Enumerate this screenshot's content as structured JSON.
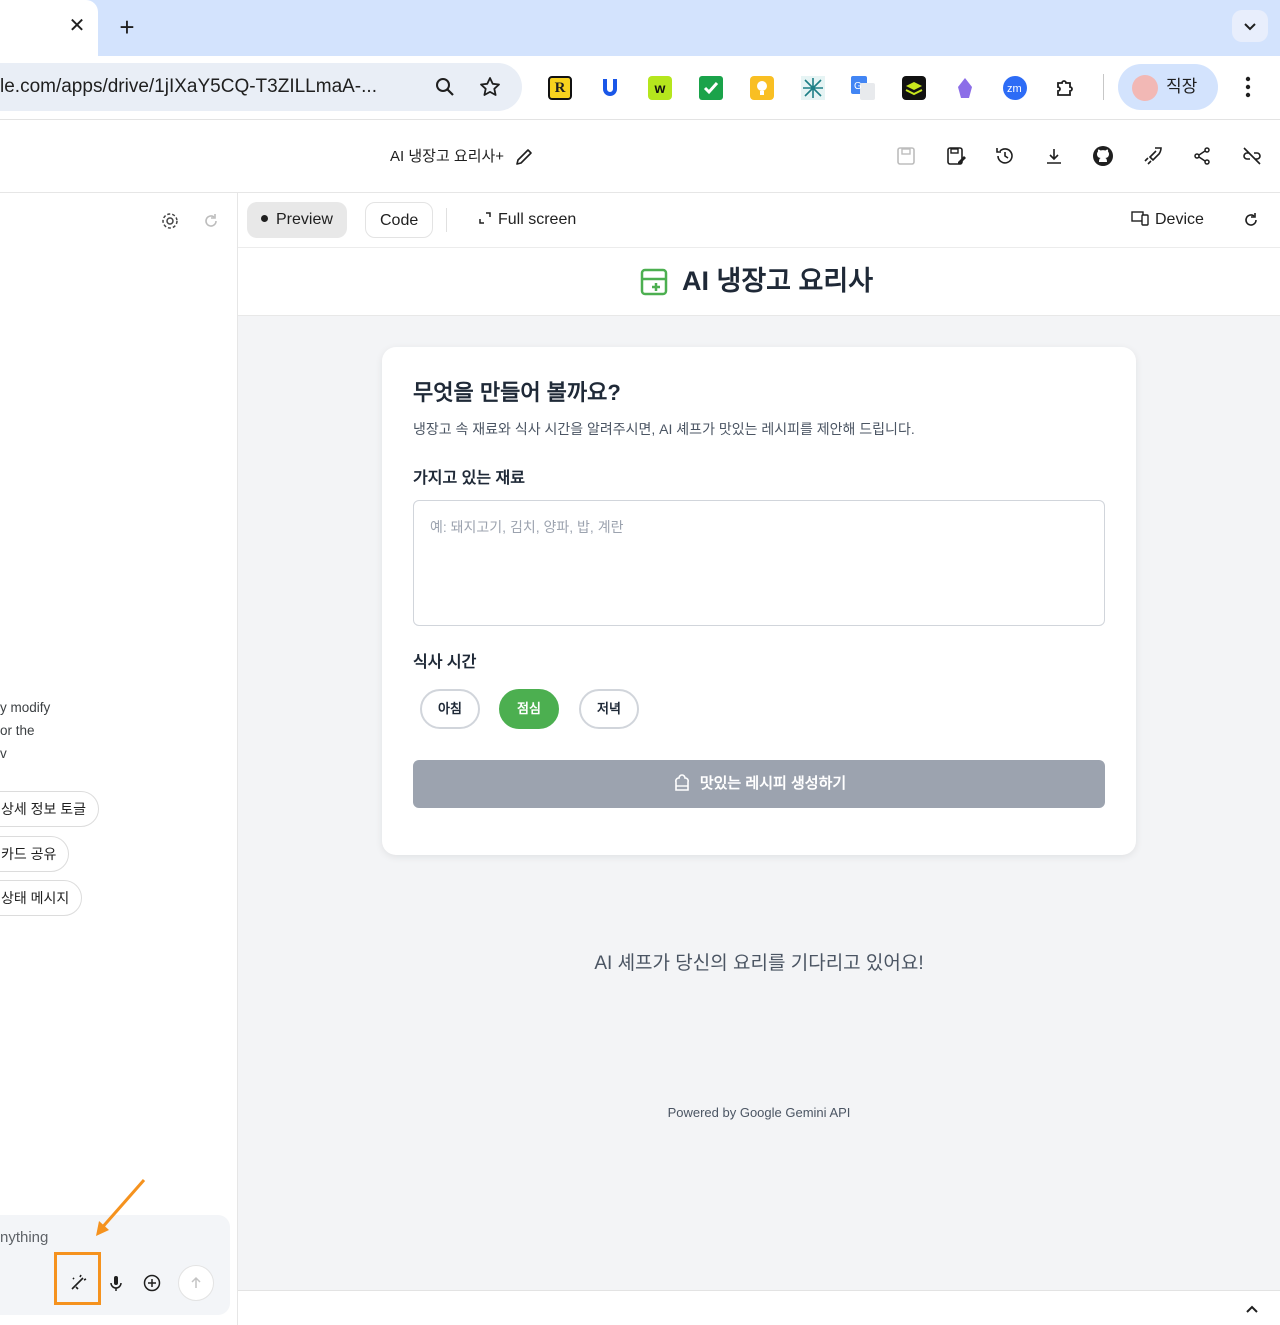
{
  "browser": {
    "tab_close_glyph": "✕",
    "new_tab_glyph": "+",
    "url": "le.com/apps/drive/1jIXaY5CQ-T3ZILLmaA-...",
    "profile_name": "직장",
    "extensions": [
      {
        "name": "r-extension-icon",
        "color": "#f7d21e"
      },
      {
        "name": "u-extension-icon",
        "color": "#1a57e8"
      },
      {
        "name": "w-extension-icon",
        "color": "#b5e61d"
      },
      {
        "name": "check-extension-icon",
        "color": "#1aa34a"
      },
      {
        "name": "bulb-extension-icon",
        "color": "#f9bf23"
      },
      {
        "name": "network-extension-icon",
        "color": "#1d7f86"
      },
      {
        "name": "translate-extension-icon",
        "color": "#4285f4"
      },
      {
        "name": "layers-extension-icon",
        "color": "#111111"
      },
      {
        "name": "crystal-extension-icon",
        "color": "#8c6ee8"
      },
      {
        "name": "zoom-extension-icon",
        "color": "#2d6cf6"
      }
    ]
  },
  "app_header": {
    "title": "AI 냉장고 요리사+"
  },
  "left_panel": {
    "text_lines": [
      "y modify",
      "or the",
      "v"
    ],
    "chips": [
      "상세 정보 토글",
      "카드 공유",
      "상태 메시지"
    ],
    "composer_placeholder": "nything"
  },
  "preview_bar": {
    "preview_label": "Preview",
    "code_label": "Code",
    "fullscreen_label": "Full screen",
    "device_label": "Device"
  },
  "app": {
    "title": "AI 냉장고 요리사",
    "card_title": "무엇을 만들어 볼까요?",
    "card_subtitle": "냉장고 속 재료와 식사 시간을 알려주시면, AI 셰프가 맛있는 레시피를 제안해 드립니다.",
    "ingredients_label": "가지고 있는 재료",
    "ingredients_value": "",
    "ingredients_placeholder": "예: 돼지고기, 김치, 양파, 밥, 계란",
    "meal_label": "식사 시간",
    "meal_options": [
      "아침",
      "점심",
      "저녁"
    ],
    "meal_selected": "점심",
    "generate_label": "맛있는 레시피 생성하기",
    "waiting_message": "AI 셰프가 당신의 요리를 기다리고 있어요!",
    "powered_by": "Powered by Google Gemini API"
  },
  "colors": {
    "accent_green": "#4caf50",
    "disabled_button": "#9ca3af",
    "highlight_orange": "#f5921e",
    "tabstrip": "#d3e3fd"
  }
}
